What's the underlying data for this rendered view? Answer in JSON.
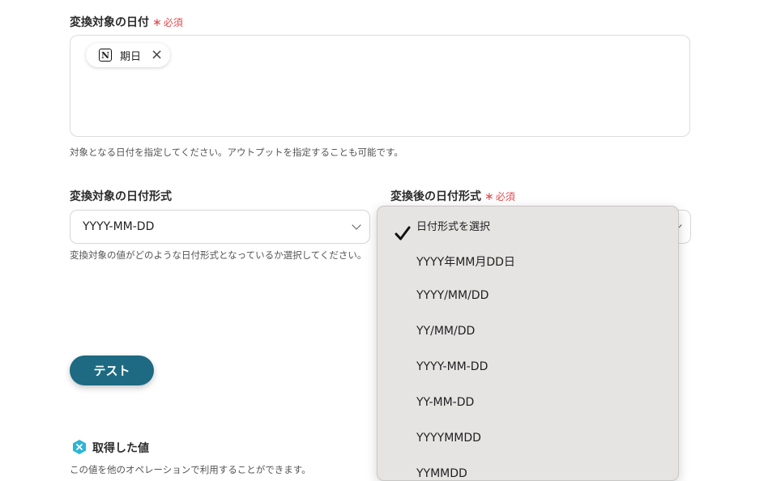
{
  "date_field": {
    "label": "変換対象の日付",
    "required_label": "必須",
    "chip_label": "期日",
    "help": "対象となる日付を指定してください。アウトプットを指定することも可能です。"
  },
  "source_format": {
    "label": "変換対象の日付形式",
    "value": "YYYY-MM-DD",
    "help": "変換対象の値がどのような日付形式となっているか選択してください。"
  },
  "target_format": {
    "label": "変換後の日付形式",
    "required_label": "必須"
  },
  "dropdown": {
    "selected_index": 0,
    "options": [
      "日付形式を選択",
      "YYYY年MM月DD日",
      "YYYY/MM/DD",
      "YY/MM/DD",
      "YYYY-MM-DD",
      "YY-MM-DD",
      "YYYYMMDD",
      "YYMMDD"
    ]
  },
  "test_button": {
    "label": "テスト"
  },
  "result": {
    "title": "取得した値",
    "help": "この値を他のオペレーションで利用することができます。"
  },
  "colors": {
    "primary": "#1d6a82",
    "required": "#e5484d",
    "dropdown_bg": "#e6e3e3"
  }
}
